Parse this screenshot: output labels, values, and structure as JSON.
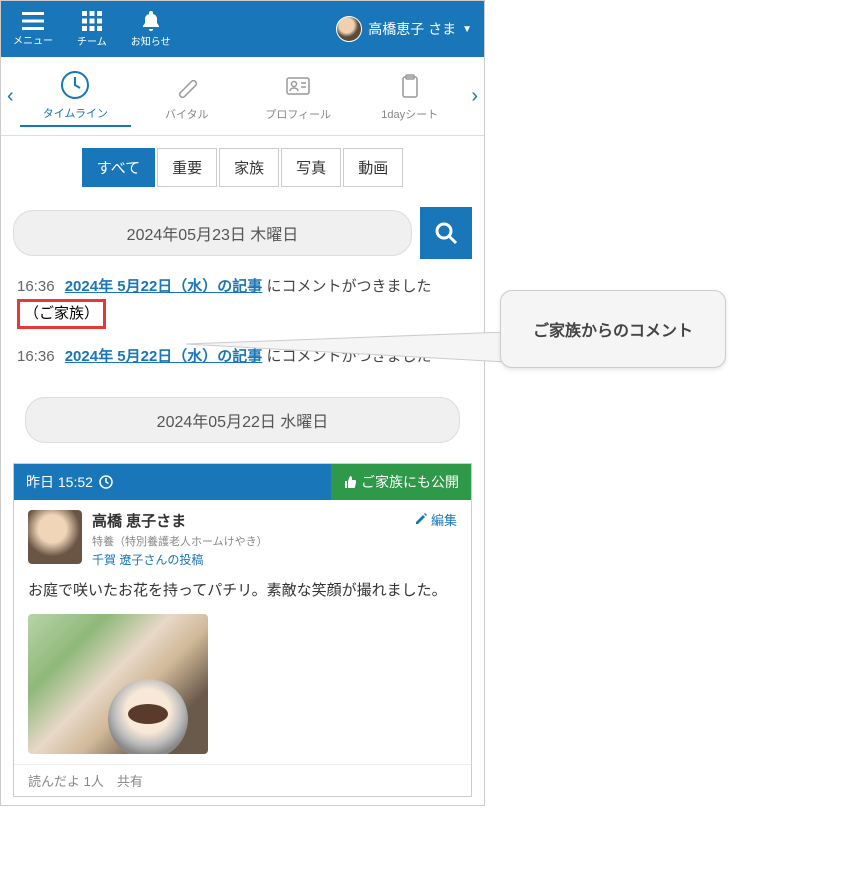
{
  "header": {
    "menu_label": "メニュー",
    "team_label": "チーム",
    "notify_label": "お知らせ",
    "user_name": "高橋恵子 さま"
  },
  "nav": {
    "tabs": [
      {
        "label": "タイムライン"
      },
      {
        "label": "バイタル"
      },
      {
        "label": "プロフィール"
      },
      {
        "label": "1dayシート"
      }
    ]
  },
  "filters": {
    "items": [
      "すべて",
      "重要",
      "家族",
      "写真",
      "動画"
    ]
  },
  "date1": "2024年05月23日 木曜日",
  "notifications": [
    {
      "time": "16:36",
      "link": "2024年 5月22日（水）の記事",
      "suffix": " にコメントがつきました",
      "family_tag": "（ご家族）",
      "highlight": true
    },
    {
      "time": "16:36",
      "link": "2024年 5月22日（水）の記事",
      "suffix": " にコメントがつきました",
      "highlight": false
    }
  ],
  "date2": "2024年05月22日 水曜日",
  "post": {
    "header_time": "昨日 15:52",
    "header_public": "ご家族にも公開",
    "user_name": "高橋 恵子さま",
    "user_sub": "特養（特別養護老人ホームけやき）",
    "user_poster": "千賀 遼子さんの投稿",
    "edit_label": "編集",
    "text": "お庭で咲いたお花を持ってパチリ。素敵な笑顔が撮れました。",
    "footer": "読んだよ 1人　共有"
  },
  "callout": {
    "text": "ご家族からのコメント"
  }
}
